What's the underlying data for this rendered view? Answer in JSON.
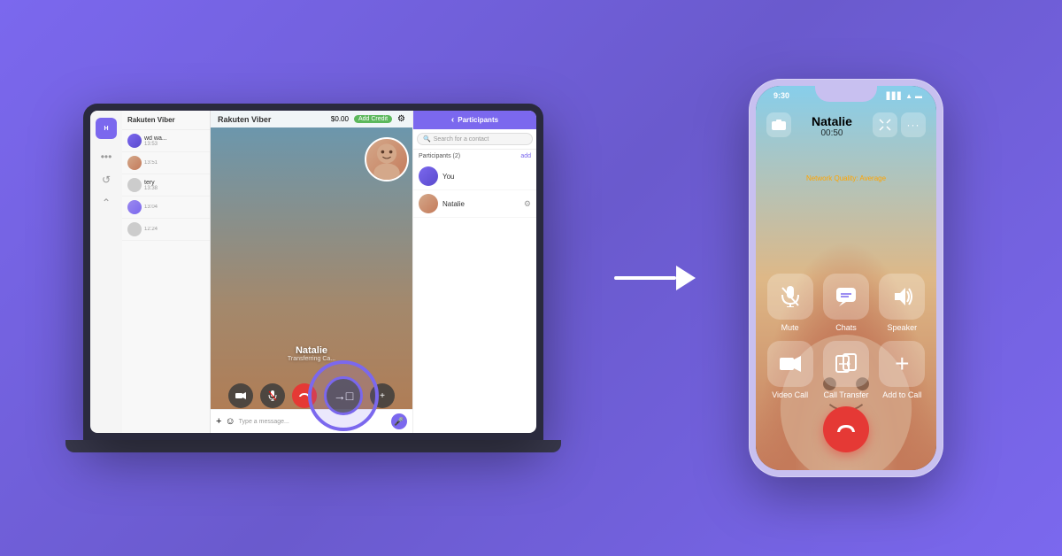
{
  "app": {
    "title": "Rakuten Viber",
    "background_color": "#7B68EE"
  },
  "laptop": {
    "top_bar": {
      "logo": "Rakuten Viber",
      "credit": "$0.00",
      "add_credit": "Add Credit"
    },
    "caller": {
      "name": "Natalie",
      "status": "Transferring Ca..."
    },
    "chat_bar": {
      "placeholder": "Type a message..."
    },
    "participants": {
      "title": "Participants",
      "search_placeholder": "Search for a contact",
      "count_label": "Participants (2)",
      "add_label": "add",
      "items": [
        {
          "name": "You"
        },
        {
          "name": "Natalie"
        }
      ]
    },
    "controls": {
      "transfer_icon": "→□"
    }
  },
  "arrow": {
    "label": "→"
  },
  "phone": {
    "status_bar": {
      "time": "9:30",
      "signal": "▋▋▋",
      "wifi": "wifi",
      "battery": "🔋"
    },
    "call": {
      "name": "Natalie",
      "duration": "00:50"
    },
    "network": {
      "label": "Network Quality:",
      "status": "Average"
    },
    "controls": [
      {
        "id": "mute",
        "label": "Mute",
        "icon": "🎤"
      },
      {
        "id": "chats",
        "label": "Chats",
        "icon": "💬"
      },
      {
        "id": "speaker",
        "label": "Speaker",
        "icon": "🔊"
      },
      {
        "id": "video-call",
        "label": "Video Call",
        "icon": "📷"
      },
      {
        "id": "call-transfer",
        "label": "Call Transfer",
        "icon": "📲"
      },
      {
        "id": "add-to-call",
        "label": "Add to Call",
        "icon": "+"
      }
    ],
    "end_call_icon": "📞"
  }
}
